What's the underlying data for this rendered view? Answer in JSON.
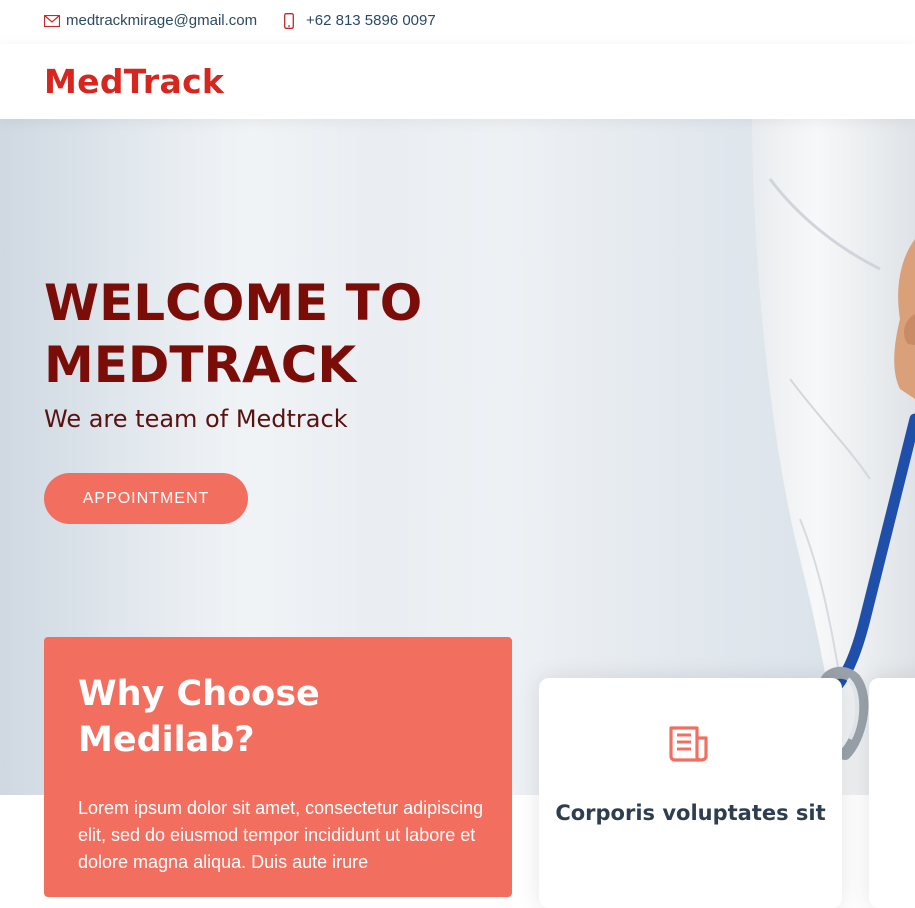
{
  "topbar": {
    "email": "medtrackmirage@gmail.com",
    "phone": "+62 813 5896 0097",
    "email_icon": "envelope-icon",
    "phone_icon": "phone-icon"
  },
  "header": {
    "logo": "MedTrack"
  },
  "hero": {
    "title_line1": "WELCOME TO",
    "title_line2": "MEDTRACK",
    "subtitle": "We are team of Medtrack",
    "button_label": "APPOINTMENT"
  },
  "why": {
    "title_line1": "Why Choose",
    "title_line2": "Medilab?",
    "text": "Lorem ipsum dolor sit amet, consectetur adipiscing elit, sed do eiusmod tempor incididunt ut labore et dolore magna aliqua. Duis aute irure"
  },
  "feature_card": {
    "icon": "document-icon",
    "title": "Corporis voluptates sit"
  },
  "colors": {
    "brand_red": "#d7261e",
    "accent_coral": "#f26f60",
    "hero_text": "#7a0d08"
  }
}
